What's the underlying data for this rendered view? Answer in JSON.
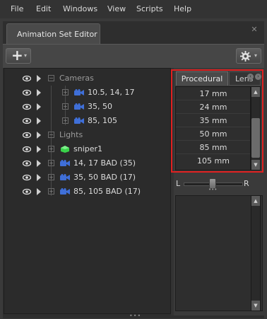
{
  "menu": [
    "File",
    "Edit",
    "Windows",
    "View",
    "Scripts",
    "Help"
  ],
  "window": {
    "tab_title": "Animation Set Editor",
    "close_glyph": "✕"
  },
  "toolbar": {
    "add_glyph": "+",
    "add_caret": "▾",
    "settings_caret": "▾"
  },
  "tree": [
    {
      "label": "Cameras",
      "kind": "folder"
    },
    {
      "label": "10.5, 14, 17",
      "kind": "camera"
    },
    {
      "label": "35, 50",
      "kind": "camera"
    },
    {
      "label": "85, 105",
      "kind": "camera"
    },
    {
      "label": "Lights",
      "kind": "folder"
    },
    {
      "label": "sniper1",
      "kind": "model"
    },
    {
      "label": "14, 17 BAD (35)",
      "kind": "camera"
    },
    {
      "label": "35, 50 BAD (17)",
      "kind": "camera"
    },
    {
      "label": "85, 105 BAD (17)",
      "kind": "camera"
    }
  ],
  "right_panel": {
    "tabs": [
      "Procedural",
      "Lens"
    ],
    "lens_values": [
      "17 mm",
      "24 mm",
      "35 mm",
      "50 mm",
      "85 mm",
      "105 mm"
    ],
    "slider_left": "L",
    "slider_right": "R",
    "slider_value": 0.5
  },
  "colors": {
    "camera": "#3f6fd8",
    "model": "#3ad24a",
    "highlight": "#e02020"
  }
}
